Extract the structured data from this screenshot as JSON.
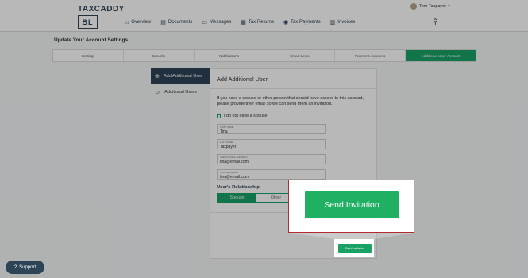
{
  "header": {
    "brand": "TAXCADDY",
    "logo_text": "BL",
    "user_name": "Tom Taxpayer",
    "nav": [
      {
        "label": "Overview",
        "icon": "home-icon"
      },
      {
        "label": "Documents",
        "icon": "documents-icon"
      },
      {
        "label": "Messages",
        "icon": "messages-icon"
      },
      {
        "label": "Tax Returns",
        "icon": "tax-returns-icon"
      },
      {
        "label": "Tax Payments",
        "icon": "tax-payments-icon"
      },
      {
        "label": "Invoices",
        "icon": "invoices-icon"
      }
    ]
  },
  "page_title": "Update Your Account Settings",
  "tabs": [
    "Settings",
    "Security",
    "Notifications",
    "Smart Links",
    "Payment Accounts",
    "Additional User Account"
  ],
  "active_tab": "Additional User Account",
  "sidebar": {
    "items": [
      {
        "label": "Add Additional User",
        "icon": "add-user-icon",
        "active": true
      },
      {
        "label": "Additional Users",
        "icon": "users-icon",
        "active": false
      }
    ]
  },
  "form": {
    "title": "Add Additional User",
    "description": "If you have a spouse or other person that should have access to this account, please provide their email so we can send them an invitation.",
    "no_spouse_label": "I do not have a spouse.",
    "fields": {
      "first_name": {
        "label": "FIRST NAME",
        "value": "Tina"
      },
      "last_name": {
        "label": "LAST NAME",
        "value": "Taxpayer"
      },
      "email": {
        "label": "USER'S EMAIL ADDRESS",
        "value": "tina@email.com"
      },
      "confirm_email": {
        "label": "CONFIRM EMAIL",
        "value": "tina@email.com"
      }
    },
    "relationship_label": "User's Relationship",
    "relationship_options": [
      "Spouse",
      "Other"
    ],
    "relationship_selected": "Spouse",
    "send_label": "Send Invitation"
  },
  "zoom_callout": {
    "label": "Send Invitation"
  },
  "support_label": "Support",
  "colors": {
    "accent": "#1aa166",
    "navy": "#2d4356",
    "callout_border": "#b5292f"
  }
}
